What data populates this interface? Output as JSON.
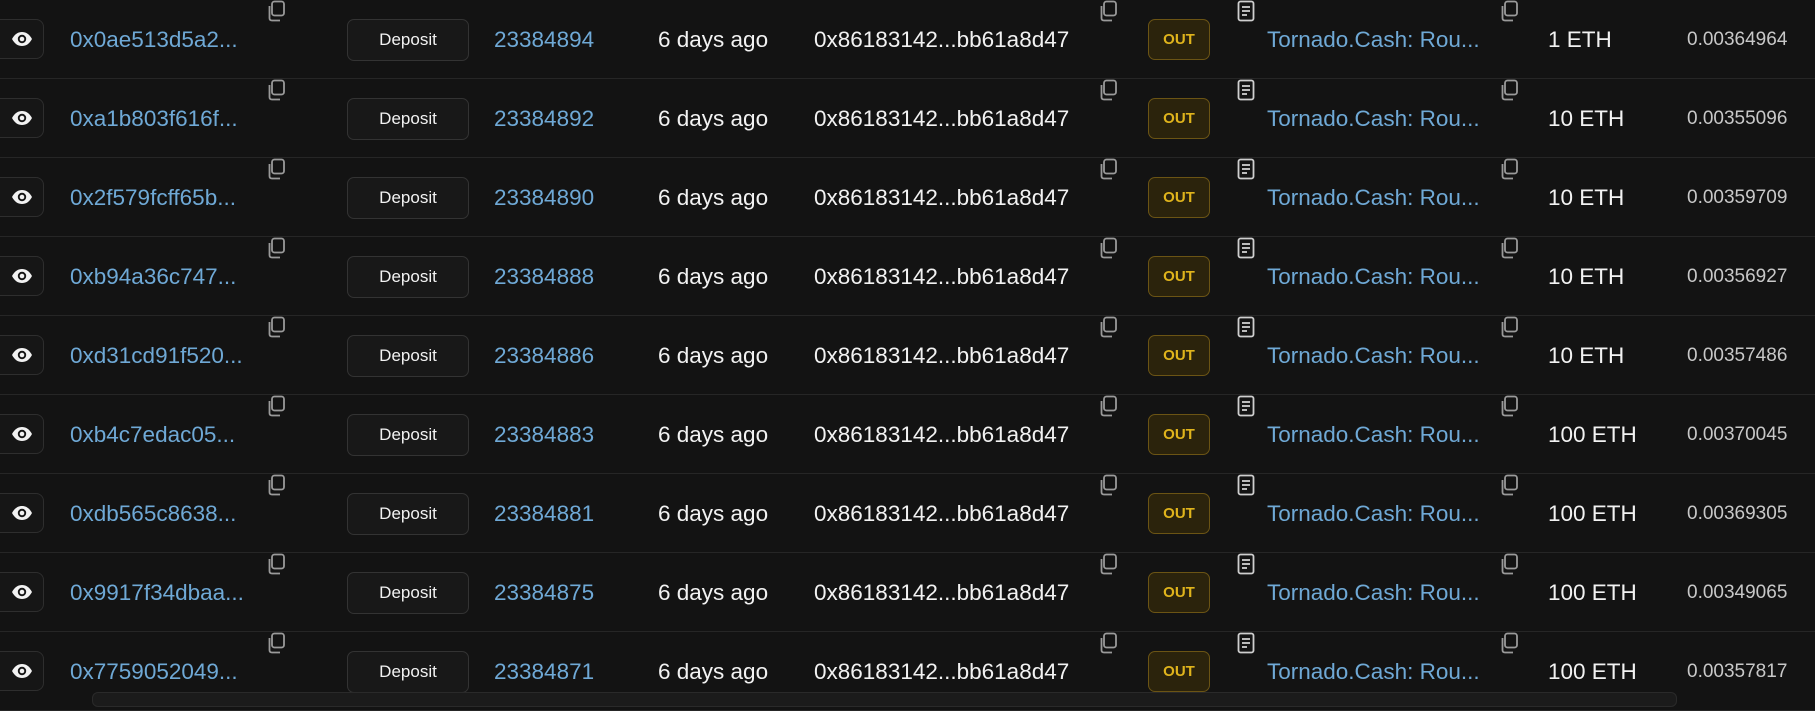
{
  "rows": [
    {
      "tx_hash": "0x0ae513d5a2...",
      "method": "Deposit",
      "block": "23384894",
      "age": "6 days ago",
      "from": "0x86183142...bb61a8d47",
      "direction": "OUT",
      "to": "Tornado.Cash: Rou...",
      "amount": "1 ETH",
      "fee": "0.00364964"
    },
    {
      "tx_hash": "0xa1b803f616f...",
      "method": "Deposit",
      "block": "23384892",
      "age": "6 days ago",
      "from": "0x86183142...bb61a8d47",
      "direction": "OUT",
      "to": "Tornado.Cash: Rou...",
      "amount": "10 ETH",
      "fee": "0.00355096"
    },
    {
      "tx_hash": "0x2f579fcff65b...",
      "method": "Deposit",
      "block": "23384890",
      "age": "6 days ago",
      "from": "0x86183142...bb61a8d47",
      "direction": "OUT",
      "to": "Tornado.Cash: Rou...",
      "amount": "10 ETH",
      "fee": "0.00359709"
    },
    {
      "tx_hash": "0xb94a36c747...",
      "method": "Deposit",
      "block": "23384888",
      "age": "6 days ago",
      "from": "0x86183142...bb61a8d47",
      "direction": "OUT",
      "to": "Tornado.Cash: Rou...",
      "amount": "10 ETH",
      "fee": "0.00356927"
    },
    {
      "tx_hash": "0xd31cd91f520...",
      "method": "Deposit",
      "block": "23384886",
      "age": "6 days ago",
      "from": "0x86183142...bb61a8d47",
      "direction": "OUT",
      "to": "Tornado.Cash: Rou...",
      "amount": "10 ETH",
      "fee": "0.00357486"
    },
    {
      "tx_hash": "0xb4c7edac05...",
      "method": "Deposit",
      "block": "23384883",
      "age": "6 days ago",
      "from": "0x86183142...bb61a8d47",
      "direction": "OUT",
      "to": "Tornado.Cash: Rou...",
      "amount": "100 ETH",
      "fee": "0.00370045"
    },
    {
      "tx_hash": "0xdb565c8638...",
      "method": "Deposit",
      "block": "23384881",
      "age": "6 days ago",
      "from": "0x86183142...bb61a8d47",
      "direction": "OUT",
      "to": "Tornado.Cash: Rou...",
      "amount": "100 ETH",
      "fee": "0.00369305"
    },
    {
      "tx_hash": "0x9917f34dbaa...",
      "method": "Deposit",
      "block": "23384875",
      "age": "6 days ago",
      "from": "0x86183142...bb61a8d47",
      "direction": "OUT",
      "to": "Tornado.Cash: Rou...",
      "amount": "100 ETH",
      "fee": "0.00349065"
    },
    {
      "tx_hash": "0x7759052049...",
      "method": "Deposit",
      "block": "23384871",
      "age": "6 days ago",
      "from": "0x86183142...bb61a8d47",
      "direction": "OUT",
      "to": "Tornado.Cash: Rou...",
      "amount": "100 ETH",
      "fee": "0.00357817"
    }
  ],
  "icons": {
    "view": "eye-icon",
    "copy": "copy-icon",
    "contract": "contract-document-icon"
  },
  "colors": {
    "link": "#6fa9d6",
    "out_badge_text": "#e0b41c",
    "out_badge_bg": "#2b230c",
    "background": "#131313"
  }
}
